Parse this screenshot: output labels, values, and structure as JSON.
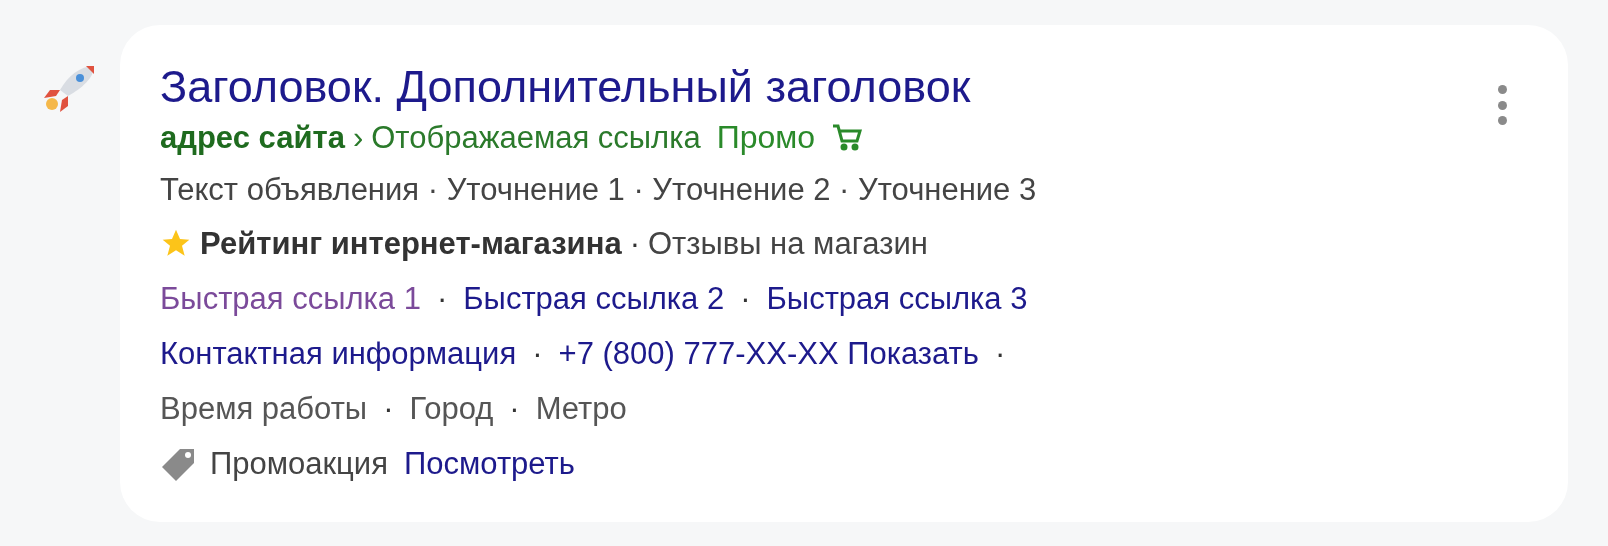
{
  "title": "Заголовок. Дополнительный заголовок",
  "site": {
    "domain": "адрес сайта",
    "arrow": "›",
    "path": "Отображаемая ссылка",
    "promo": "Промо"
  },
  "ad_text": "Текст объявления · Уточнение 1 · Уточнение 2 · Уточнение 3",
  "rating": {
    "label": "Рейтинг интернет-магазина",
    "dot": "·",
    "reviews": "Отзывы на магазин"
  },
  "lines": [
    [
      {
        "kind": "link",
        "text": "Быстрая ссылка 1",
        "visited": true
      },
      {
        "kind": "dot",
        "text": "·"
      },
      {
        "kind": "link",
        "text": "Быстрая ссылка 2",
        "visited": false
      },
      {
        "kind": "dot",
        "text": "·"
      },
      {
        "kind": "link",
        "text": "Быстрая ссылка 3",
        "visited": false
      }
    ],
    [
      {
        "kind": "link",
        "text": "Контактная информация",
        "visited": false
      },
      {
        "kind": "dot",
        "text": "·"
      },
      {
        "kind": "link",
        "text": "+7 (800) 777-XX-XX Показать",
        "visited": false
      },
      {
        "kind": "dot",
        "text": "·"
      }
    ],
    [
      {
        "kind": "text",
        "text": "Время работы"
      },
      {
        "kind": "dot",
        "text": "·"
      },
      {
        "kind": "text",
        "text": "Город"
      },
      {
        "kind": "dot",
        "text": "·"
      },
      {
        "kind": "text",
        "text": "Метро"
      }
    ]
  ],
  "promo": {
    "label": "Промоакция",
    "link": "Посмотреть"
  }
}
